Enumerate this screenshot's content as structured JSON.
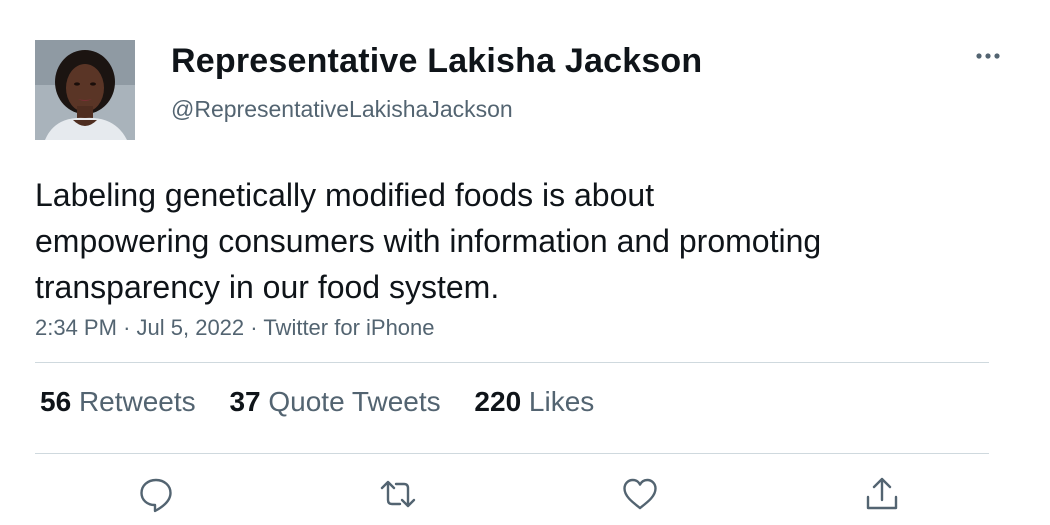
{
  "tweet": {
    "author": {
      "name": "Representative Lakisha Jackson",
      "handle": "@RepresentativeLakishaJackson",
      "avatar_icon": "profile-photo"
    },
    "more_icon": "more-horizontal-icon",
    "text": "Labeling genetically modified foods is about\nempowering consumers with information and promoting\ntransparency in our food system.",
    "meta": {
      "time": "2:34 PM",
      "separator1": "·",
      "date": "Jul 5, 2022",
      "separator2": "·",
      "source": "Twitter for iPhone"
    },
    "stats": {
      "retweets": {
        "count": "56",
        "label": "Retweets"
      },
      "quotes": {
        "count": "37",
        "label": "Quote Tweets"
      },
      "likes": {
        "count": "220",
        "label": "Likes"
      }
    },
    "actions": [
      {
        "icon": "reply-icon"
      },
      {
        "icon": "retweet-icon"
      },
      {
        "icon": "like-icon"
      },
      {
        "icon": "share-icon"
      }
    ]
  },
  "colors": {
    "text_primary": "#0f1419",
    "text_secondary": "#536471",
    "divider": "#cfd9de"
  }
}
